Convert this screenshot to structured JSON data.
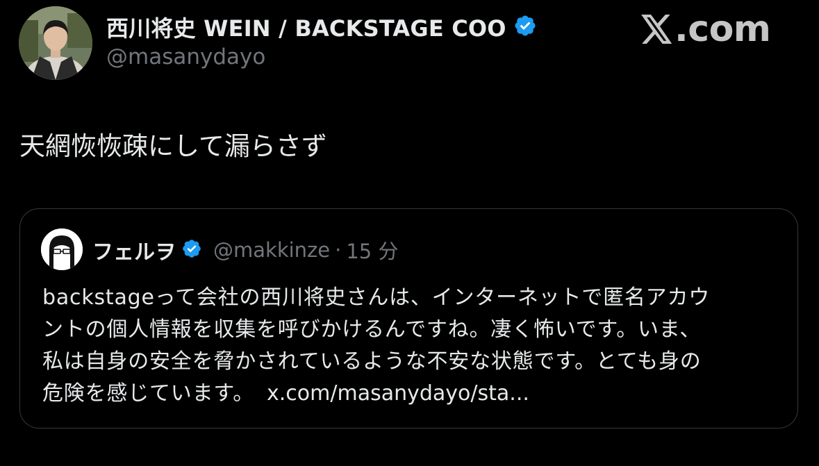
{
  "author": {
    "name": "西川将史 WEIN / BACKSTAGE COO",
    "handle": "@masanydayo",
    "verified": true
  },
  "brand": {
    "logo_letter": "𝕏",
    "domain_suffix": ".com"
  },
  "tweet": {
    "text": "天網恢恢疎にして漏らさず"
  },
  "quote": {
    "name": "フェルヲ",
    "handle": "@makkinze",
    "separator": "·",
    "time": "15 分",
    "verified": true,
    "body_lines": [
      "backstageって会社の西川将史さんは、インターネットで匿名アカウ",
      "ントの個人情報を収集を呼びかけるんですね。凄く怖いです。いま、",
      "私は自身の安全を脅かされているような不安な状態です。とても身の",
      "危険を感じています。"
    ],
    "link_text": "x.com/masanydayo/sta..."
  },
  "icons": {
    "verified_badge": "verified-badge-icon",
    "x_logo": "x-logo-icon"
  },
  "colors": {
    "background": "#000000",
    "text_primary": "#e7e9ea",
    "text_secondary": "#71767b",
    "verified_blue": "#1d9bf0",
    "card_border": "#36393d"
  }
}
